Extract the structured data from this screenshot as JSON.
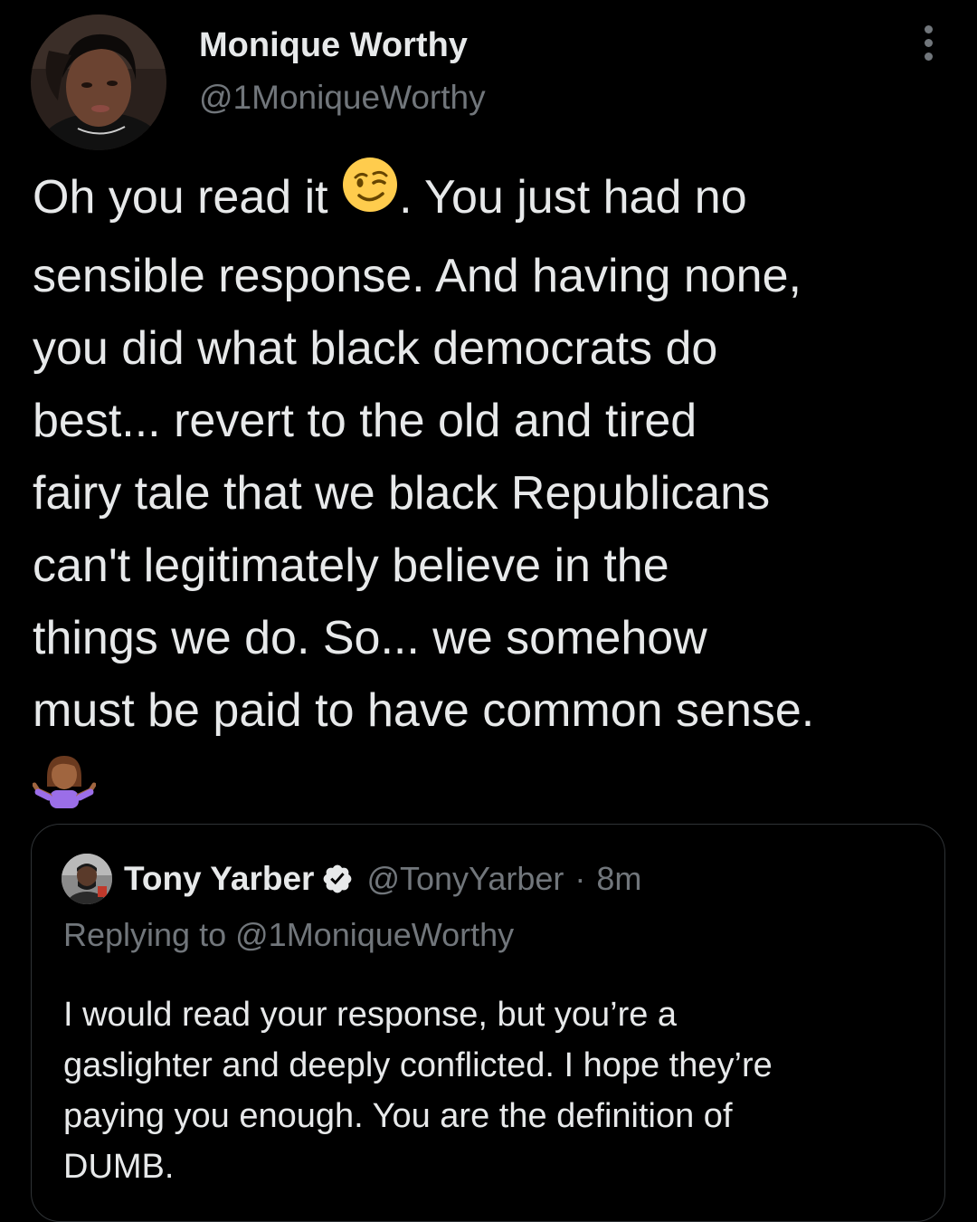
{
  "tweet": {
    "author": {
      "display_name": "Monique Worthy",
      "handle": "@1MoniqueWorthy"
    },
    "text_lines": [
      "Oh you read it",
      ". You just had no",
      "sensible response. And having none,",
      "you did what black democrats do",
      "best... revert to the old and tired",
      "fairy tale that we black Republicans",
      "can't legitimately believe in the",
      "things we do. So... we somehow",
      "must be paid to have common sense."
    ],
    "emojis": [
      "winking-face-emoji",
      "woman-shrugging-emoji"
    ]
  },
  "quote": {
    "author": {
      "display_name": "Tony Yarber",
      "handle": "@TonyYarber",
      "separator": "·",
      "time": "8m",
      "verified": true
    },
    "replying_prefix": "Replying to",
    "replying_to": "@1MoniqueWorthy",
    "text_lines": [
      "I would read your response, but you’re a",
      "gaslighter and deeply conflicted. I hope they’re",
      "paying you enough. You are the definition of",
      "DUMB."
    ]
  },
  "colors": {
    "background": "#000000",
    "primary_text": "#e7e9ea",
    "secondary_text": "#71767b",
    "border": "#2f3336",
    "verified_badge": "#e7e9ea"
  }
}
